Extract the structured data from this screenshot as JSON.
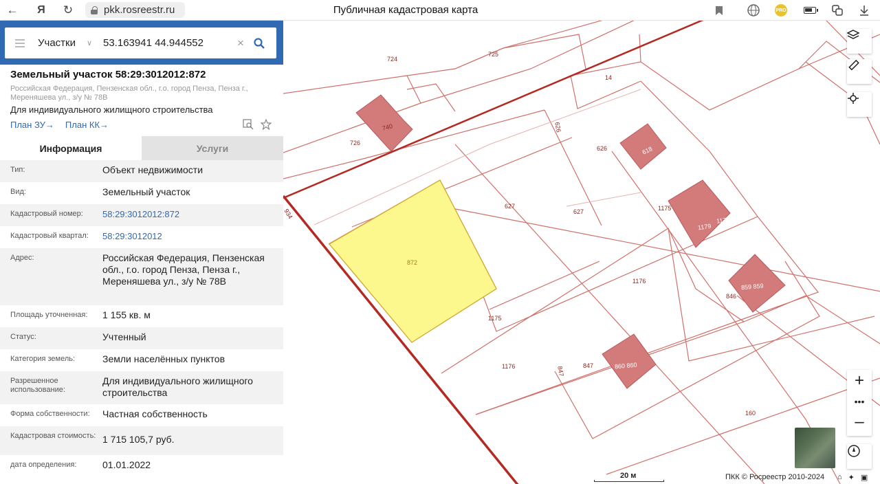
{
  "browser": {
    "url": "pkk.rosreestr.ru",
    "page_title": "Публичная кадастровая карта"
  },
  "search": {
    "type": "Участки",
    "value": "53.163941 44.944552"
  },
  "object": {
    "title": "Земельный участок 58:29:3012012:872",
    "address_short": "Российская Федерация, Пензенская обл., г.о. город Пенза, Пенза г., Мереняшева ул., з/у № 78В",
    "use": "Для индивидуального жилищного строительства",
    "plan_zu": "План ЗУ→",
    "plan_kk": "План КК→"
  },
  "tabs": {
    "info": "Информация",
    "services": "Услуги"
  },
  "rows": [
    {
      "key": "Тип:",
      "value": "Объект недвижимости"
    },
    {
      "key": "Вид:",
      "value": "Земельный участок"
    },
    {
      "key": "Кадастровый номер:",
      "value": "58:29:3012012:872"
    },
    {
      "key": "Кадастровый квартал:",
      "value": "58:29:3012012"
    },
    {
      "key": "Адрес:",
      "value": "Российская Федерация, Пензенская обл., г.о. город Пенза, Пенза г., Мереняшева ул., з/у № 78В"
    },
    {
      "key": "Площадь уточненная:",
      "value": "1 155 кв. м"
    },
    {
      "key": "Статус:",
      "value": "Учтенный"
    },
    {
      "key": "Категория земель:",
      "value": "Земли населённых пунктов"
    },
    {
      "key": "Разрешенное использование:",
      "value": "Для индивидуального жилищного строительства"
    },
    {
      "key": "Форма собственности:",
      "value": "Частная собственность"
    },
    {
      "key": "Кадастровая стоимость:",
      "value": "1 715 105,7 руб."
    },
    {
      "key": "дата определения:",
      "value": "01.01.2022"
    }
  ],
  "map": {
    "labels": {
      "l724": "724",
      "l725": "725",
      "l14": "14",
      "l740": "740",
      "l726": "726",
      "l626a": "626",
      "l626b": "626",
      "l618": "618",
      "l627a": "627",
      "l627b": "627",
      "l1175a": "1175",
      "l1175b": "1175",
      "l1179": "1179 1179",
      "l1179b": "1179",
      "l872": "872",
      "l1176a": "1176",
      "l1176b": "1176",
      "l859": "859 859",
      "l846": "846",
      "l847a": "847",
      "l847b": "847",
      "l860": "860 860",
      "l160": "160",
      "l934": "934"
    },
    "scale": "20 м",
    "copyright": "ПКК © Росреестр 2010-2024"
  },
  "colors": {
    "accent": "#2f6ab3",
    "parcel_border": "#c0392b",
    "selected_fill": "#fdf88e",
    "building_fill": "#d37a7a"
  }
}
